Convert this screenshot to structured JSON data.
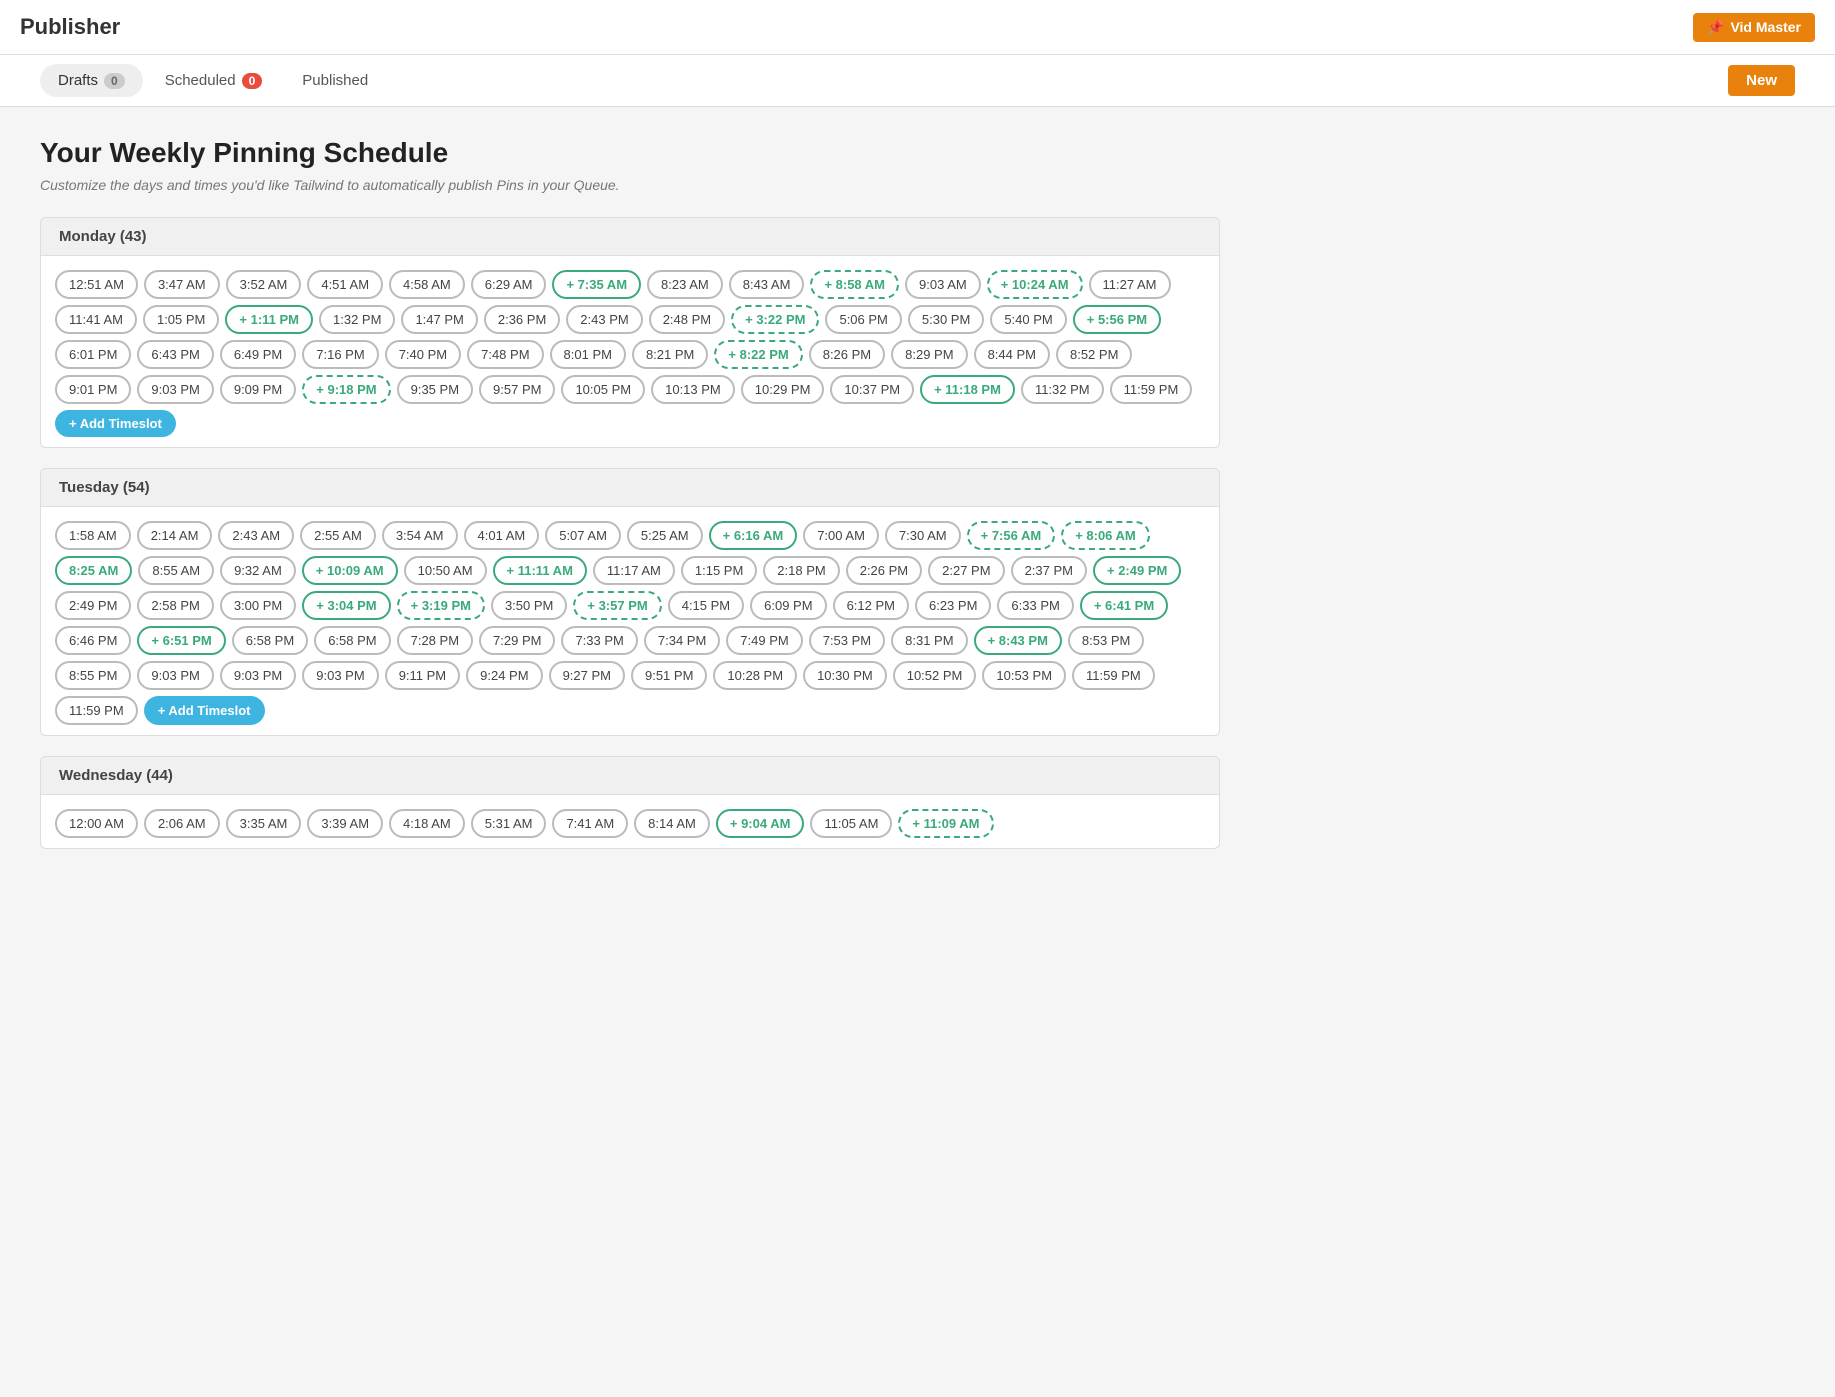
{
  "topbar": {
    "title": "Publisher",
    "right_label": "Vid Master",
    "right_icon": "📌"
  },
  "tabs": [
    {
      "id": "drafts",
      "label": "Drafts",
      "badge": "0",
      "badge_type": "normal"
    },
    {
      "id": "scheduled",
      "label": "Scheduled",
      "badge": "0",
      "badge_type": "red"
    },
    {
      "id": "published",
      "label": "Published",
      "badge": "",
      "badge_type": ""
    }
  ],
  "new_button_label": "New",
  "page_title": "Your Weekly Pinning Schedule",
  "page_subtitle": "Customize the days and times you'd like Tailwind to automatically publish Pins in your Queue.",
  "days": [
    {
      "name": "Monday (43)",
      "slots": [
        {
          "time": "12:51 AM",
          "type": "normal"
        },
        {
          "time": "3:47 AM",
          "type": "normal"
        },
        {
          "time": "3:52 AM",
          "type": "normal"
        },
        {
          "time": "4:51 AM",
          "type": "normal"
        },
        {
          "time": "4:58 AM",
          "type": "normal"
        },
        {
          "time": "6:29 AM",
          "type": "normal"
        },
        {
          "time": "+ 7:35 AM",
          "type": "green"
        },
        {
          "time": "8:23 AM",
          "type": "normal"
        },
        {
          "time": "8:43 AM",
          "type": "normal"
        },
        {
          "time": "+ 8:58 AM",
          "type": "dashed"
        },
        {
          "time": "9:03 AM",
          "type": "normal"
        },
        {
          "time": "+ 10:24 AM",
          "type": "dashed"
        },
        {
          "time": "11:27 AM",
          "type": "normal"
        },
        {
          "time": "11:41 AM",
          "type": "normal"
        },
        {
          "time": "1:05 PM",
          "type": "normal"
        },
        {
          "time": "+ 1:11 PM",
          "type": "green"
        },
        {
          "time": "1:32 PM",
          "type": "normal"
        },
        {
          "time": "1:47 PM",
          "type": "normal"
        },
        {
          "time": "2:36 PM",
          "type": "normal"
        },
        {
          "time": "2:43 PM",
          "type": "normal"
        },
        {
          "time": "2:48 PM",
          "type": "normal"
        },
        {
          "time": "+ 3:22 PM",
          "type": "dashed"
        },
        {
          "time": "5:06 PM",
          "type": "normal"
        },
        {
          "time": "5:30 PM",
          "type": "normal"
        },
        {
          "time": "5:40 PM",
          "type": "normal"
        },
        {
          "time": "+ 5:56 PM",
          "type": "green"
        },
        {
          "time": "6:01 PM",
          "type": "normal"
        },
        {
          "time": "6:43 PM",
          "type": "normal"
        },
        {
          "time": "6:49 PM",
          "type": "normal"
        },
        {
          "time": "7:16 PM",
          "type": "normal"
        },
        {
          "time": "7:40 PM",
          "type": "normal"
        },
        {
          "time": "7:48 PM",
          "type": "normal"
        },
        {
          "time": "8:01 PM",
          "type": "normal"
        },
        {
          "time": "8:21 PM",
          "type": "normal"
        },
        {
          "time": "+ 8:22 PM",
          "type": "dashed"
        },
        {
          "time": "8:26 PM",
          "type": "normal"
        },
        {
          "time": "8:29 PM",
          "type": "normal"
        },
        {
          "time": "8:44 PM",
          "type": "normal"
        },
        {
          "time": "8:52 PM",
          "type": "normal"
        },
        {
          "time": "9:01 PM",
          "type": "normal"
        },
        {
          "time": "9:03 PM",
          "type": "normal"
        },
        {
          "time": "9:09 PM",
          "type": "normal"
        },
        {
          "time": "+ 9:18 PM",
          "type": "dashed"
        },
        {
          "time": "9:35 PM",
          "type": "normal"
        },
        {
          "time": "9:57 PM",
          "type": "normal"
        },
        {
          "time": "10:05 PM",
          "type": "normal"
        },
        {
          "time": "10:13 PM",
          "type": "normal"
        },
        {
          "time": "10:29 PM",
          "type": "normal"
        },
        {
          "time": "10:37 PM",
          "type": "normal"
        },
        {
          "time": "+ 11:18 PM",
          "type": "green"
        },
        {
          "time": "11:32 PM",
          "type": "normal"
        },
        {
          "time": "11:59 PM",
          "type": "normal"
        },
        {
          "time": "+ Add Timeslot",
          "type": "add"
        }
      ]
    },
    {
      "name": "Tuesday (54)",
      "slots": [
        {
          "time": "1:58 AM",
          "type": "normal"
        },
        {
          "time": "2:14 AM",
          "type": "normal"
        },
        {
          "time": "2:43 AM",
          "type": "normal"
        },
        {
          "time": "2:55 AM",
          "type": "normal"
        },
        {
          "time": "3:54 AM",
          "type": "normal"
        },
        {
          "time": "4:01 AM",
          "type": "normal"
        },
        {
          "time": "5:07 AM",
          "type": "normal"
        },
        {
          "time": "5:25 AM",
          "type": "normal"
        },
        {
          "time": "+ 6:16 AM",
          "type": "green"
        },
        {
          "time": "7:00 AM",
          "type": "normal"
        },
        {
          "time": "7:30 AM",
          "type": "normal"
        },
        {
          "time": "+ 7:56 AM",
          "type": "dashed"
        },
        {
          "time": "+ 8:06 AM",
          "type": "dashed"
        },
        {
          "time": "8:25 AM",
          "type": "green"
        },
        {
          "time": "8:55 AM",
          "type": "normal"
        },
        {
          "time": "9:32 AM",
          "type": "normal"
        },
        {
          "time": "+ 10:09 AM",
          "type": "green"
        },
        {
          "time": "10:50 AM",
          "type": "normal"
        },
        {
          "time": "+ 11:11 AM",
          "type": "green"
        },
        {
          "time": "11:17 AM",
          "type": "normal"
        },
        {
          "time": "1:15 PM",
          "type": "normal"
        },
        {
          "time": "2:18 PM",
          "type": "normal"
        },
        {
          "time": "2:26 PM",
          "type": "normal"
        },
        {
          "time": "2:27 PM",
          "type": "normal"
        },
        {
          "time": "2:37 PM",
          "type": "normal"
        },
        {
          "time": "+ 2:49 PM",
          "type": "green"
        },
        {
          "time": "2:49 PM",
          "type": "normal"
        },
        {
          "time": "2:58 PM",
          "type": "normal"
        },
        {
          "time": "3:00 PM",
          "type": "normal"
        },
        {
          "time": "+ 3:04 PM",
          "type": "green"
        },
        {
          "time": "+ 3:19 PM",
          "type": "dashed"
        },
        {
          "time": "3:50 PM",
          "type": "normal"
        },
        {
          "time": "+ 3:57 PM",
          "type": "dashed"
        },
        {
          "time": "4:15 PM",
          "type": "normal"
        },
        {
          "time": "6:09 PM",
          "type": "normal"
        },
        {
          "time": "6:12 PM",
          "type": "normal"
        },
        {
          "time": "6:23 PM",
          "type": "normal"
        },
        {
          "time": "6:33 PM",
          "type": "normal"
        },
        {
          "time": "+ 6:41 PM",
          "type": "green"
        },
        {
          "time": "6:46 PM",
          "type": "normal"
        },
        {
          "time": "+ 6:51 PM",
          "type": "green"
        },
        {
          "time": "6:58 PM",
          "type": "normal"
        },
        {
          "time": "6:58 PM",
          "type": "normal"
        },
        {
          "time": "7:28 PM",
          "type": "normal"
        },
        {
          "time": "7:29 PM",
          "type": "normal"
        },
        {
          "time": "7:33 PM",
          "type": "normal"
        },
        {
          "time": "7:34 PM",
          "type": "normal"
        },
        {
          "time": "7:49 PM",
          "type": "normal"
        },
        {
          "time": "7:53 PM",
          "type": "normal"
        },
        {
          "time": "8:31 PM",
          "type": "normal"
        },
        {
          "time": "+ 8:43 PM",
          "type": "green"
        },
        {
          "time": "8:53 PM",
          "type": "normal"
        },
        {
          "time": "8:55 PM",
          "type": "normal"
        },
        {
          "time": "9:03 PM",
          "type": "normal"
        },
        {
          "time": "9:03 PM",
          "type": "normal"
        },
        {
          "time": "9:03 PM",
          "type": "normal"
        },
        {
          "time": "9:11 PM",
          "type": "normal"
        },
        {
          "time": "9:24 PM",
          "type": "normal"
        },
        {
          "time": "9:27 PM",
          "type": "normal"
        },
        {
          "time": "9:51 PM",
          "type": "normal"
        },
        {
          "time": "10:28 PM",
          "type": "normal"
        },
        {
          "time": "10:30 PM",
          "type": "normal"
        },
        {
          "time": "10:52 PM",
          "type": "normal"
        },
        {
          "time": "10:53 PM",
          "type": "normal"
        },
        {
          "time": "11:59 PM",
          "type": "normal"
        },
        {
          "time": "11:59 PM",
          "type": "normal"
        },
        {
          "time": "+ Add Timeslot",
          "type": "add"
        }
      ]
    },
    {
      "name": "Wednesday (44)",
      "slots": [
        {
          "time": "12:00 AM",
          "type": "normal"
        },
        {
          "time": "2:06 AM",
          "type": "normal"
        },
        {
          "time": "3:35 AM",
          "type": "normal"
        },
        {
          "time": "3:39 AM",
          "type": "normal"
        },
        {
          "time": "4:18 AM",
          "type": "normal"
        },
        {
          "time": "5:31 AM",
          "type": "normal"
        },
        {
          "time": "7:41 AM",
          "type": "normal"
        },
        {
          "time": "8:14 AM",
          "type": "normal"
        },
        {
          "time": "+ 9:04 AM",
          "type": "green"
        },
        {
          "time": "11:05 AM",
          "type": "normal"
        },
        {
          "time": "+ 11:09 AM",
          "type": "dashed"
        }
      ]
    }
  ]
}
